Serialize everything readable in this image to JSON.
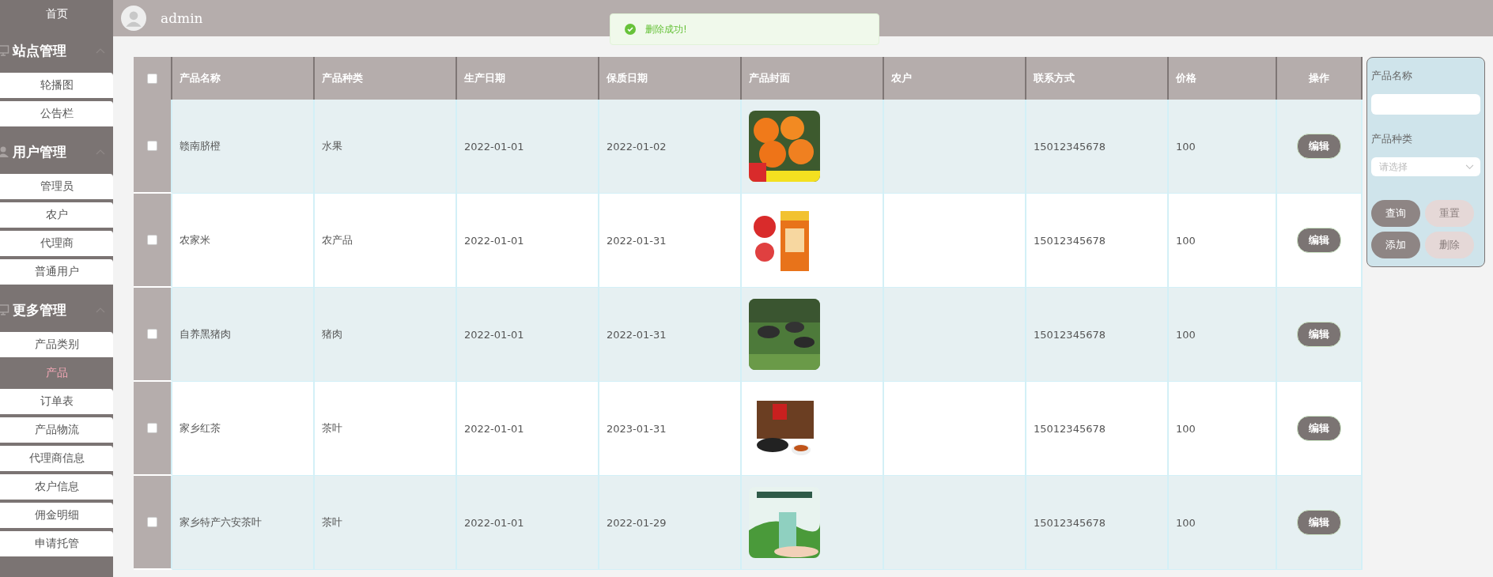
{
  "header": {
    "username": "admin"
  },
  "toast": {
    "message": "删除成功!"
  },
  "sidebar": {
    "items": [
      {
        "kind": "link",
        "label": "首页",
        "selected": false
      },
      {
        "kind": "group",
        "label": "站点管理",
        "expanded": true,
        "children": [
          {
            "label": "轮播图",
            "selected": false
          },
          {
            "label": "公告栏",
            "selected": false
          }
        ]
      },
      {
        "kind": "group",
        "label": "用户管理",
        "expanded": true,
        "children": [
          {
            "label": "管理员",
            "selected": false
          },
          {
            "label": "农户",
            "selected": false
          },
          {
            "label": "代理商",
            "selected": false
          },
          {
            "label": "普通用户",
            "selected": false
          }
        ]
      },
      {
        "kind": "group",
        "label": "更多管理",
        "expanded": true,
        "children": [
          {
            "label": "产品类别",
            "selected": false
          },
          {
            "label": "产品",
            "selected": true
          },
          {
            "label": "订单表",
            "selected": false
          },
          {
            "label": "产品物流",
            "selected": false
          },
          {
            "label": "代理商信息",
            "selected": false
          },
          {
            "label": "农户信息",
            "selected": false
          },
          {
            "label": "佣金明细",
            "selected": false
          },
          {
            "label": "申请托管",
            "selected": false
          }
        ]
      }
    ]
  },
  "table": {
    "select_all": {
      "checked": false
    },
    "columns": [
      "产品名称",
      "产品种类",
      "生产日期",
      "保质日期",
      "产品封面",
      "农户",
      "联系方式",
      "价格",
      "操作"
    ],
    "rows": [
      {
        "checked": false,
        "name": "赣南脐橙",
        "category": "水果",
        "produced": "2022-01-01",
        "expiry": "2022-01-02",
        "phone": "15012345678",
        "price": "100",
        "action": "编辑"
      },
      {
        "checked": false,
        "name": "农家米",
        "category": "农产品",
        "produced": "2022-01-01",
        "expiry": "2022-01-31",
        "phone": "15012345678",
        "price": "100",
        "action": "编辑"
      },
      {
        "checked": false,
        "name": "自养黑猪肉",
        "category": "猪肉",
        "produced": "2022-01-01",
        "expiry": "2022-01-31",
        "phone": "15012345678",
        "price": "100",
        "action": "编辑"
      },
      {
        "checked": false,
        "name": "家乡红茶",
        "category": "茶叶",
        "produced": "2022-01-01",
        "expiry": "2023-01-31",
        "phone": "15012345678",
        "price": "100",
        "action": "编辑"
      },
      {
        "checked": false,
        "name": "家乡特产六安茶叶",
        "category": "茶叶",
        "produced": "2022-01-01",
        "expiry": "2022-01-29",
        "phone": "15012345678",
        "price": "100",
        "action": "编辑"
      }
    ]
  },
  "search": {
    "fields": [
      {
        "kind": "text",
        "label": "产品名称"
      },
      {
        "kind": "select",
        "label": "产品种类",
        "placeholder": "请选择"
      }
    ],
    "buttons": [
      {
        "label": "查询",
        "disabled": false
      },
      {
        "label": "重置",
        "disabled": true
      },
      {
        "label": "添加",
        "disabled": false
      },
      {
        "label": "删除",
        "disabled": true
      }
    ]
  }
}
